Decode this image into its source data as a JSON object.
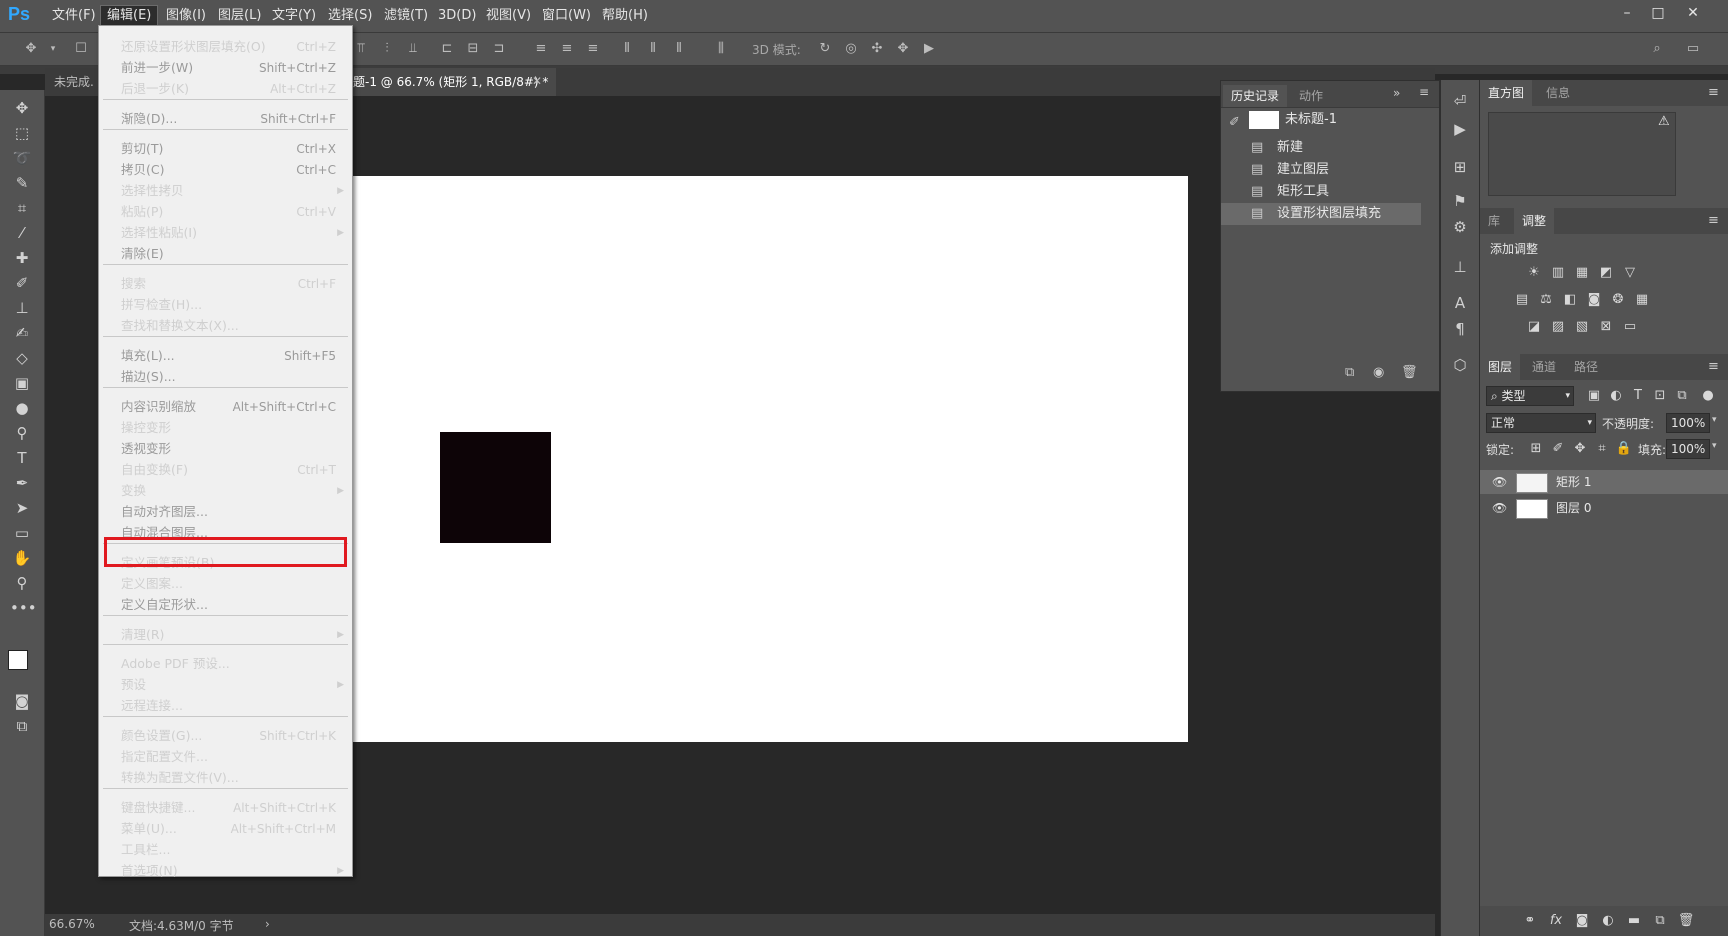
{
  "app": {
    "logo": "Ps"
  },
  "menubar": {
    "items": [
      "文件(F)",
      "编辑(E)",
      "图像(I)",
      "图层(L)",
      "文字(Y)",
      "选择(S)",
      "滤镜(T)",
      "3D(D)",
      "视图(V)",
      "窗口(W)",
      "帮助(H)"
    ],
    "window_controls": [
      "minimize-icon",
      "maximize-icon",
      "close-icon"
    ]
  },
  "options_bar": {
    "mode_label": "3D 模式:"
  },
  "document": {
    "tab_left": "未完成.",
    "tab_active": "题-1 @ 66.7% (矩形 1, RGB/8#) *",
    "status_zoom": "66.67%",
    "status_doc": "文档:4.63M/0 字节"
  },
  "history_panel": {
    "tabs": [
      "历史记录",
      "动作"
    ],
    "snapshot": "未标题-1",
    "items": [
      "新建",
      "建立图层",
      "矩形工具",
      "设置形状图层填充"
    ]
  },
  "histogram_panel": {
    "tabs": [
      "直方图",
      "信息"
    ]
  },
  "adjustments_panel": {
    "tabs": [
      "库",
      "调整"
    ],
    "title": "添加调整"
  },
  "layers_panel": {
    "tabs": [
      "图层",
      "通道",
      "路径"
    ],
    "filter_label": "类型",
    "blend_mode": "正常",
    "opacity_label": "不透明度:",
    "opacity_value": "100%",
    "lock_label": "锁定:",
    "fill_label": "填充:",
    "fill_value": "100%",
    "layers": [
      "矩形 1",
      "图层 0"
    ]
  },
  "edit_menu": {
    "items": [
      {
        "label": "还原设置形状图层填充(O)",
        "shortcut": "Ctrl+Z",
        "disabled": false
      },
      {
        "label": "前进一步(W)",
        "shortcut": "Shift+Ctrl+Z",
        "disabled": true
      },
      {
        "label": "后退一步(K)",
        "shortcut": "Alt+Ctrl+Z",
        "disabled": false
      },
      {
        "label": "渐隐(D)...",
        "shortcut": "Shift+Ctrl+F",
        "disabled": true
      },
      {
        "label": "剪切(T)",
        "shortcut": "Ctrl+X",
        "disabled": true
      },
      {
        "label": "拷贝(C)",
        "shortcut": "Ctrl+C",
        "disabled": true
      },
      {
        "label": "选择性拷贝",
        "shortcut": "",
        "disabled": false
      },
      {
        "label": "粘贴(P)",
        "shortcut": "Ctrl+V",
        "disabled": false
      },
      {
        "label": "选择性粘贴(I)",
        "shortcut": "",
        "disabled": false
      },
      {
        "label": "清除(E)",
        "shortcut": "",
        "disabled": true
      },
      {
        "label": "搜索",
        "shortcut": "Ctrl+F",
        "disabled": false
      },
      {
        "label": "拼写检查(H)...",
        "shortcut": "",
        "disabled": false
      },
      {
        "label": "查找和替换文本(X)...",
        "shortcut": "",
        "disabled": false
      },
      {
        "label": "填充(L)...",
        "shortcut": "Shift+F5",
        "disabled": true
      },
      {
        "label": "描边(S)...",
        "shortcut": "",
        "disabled": true
      },
      {
        "label": "内容识别缩放",
        "shortcut": "Alt+Shift+Ctrl+C",
        "disabled": true
      },
      {
        "label": "操控变形",
        "shortcut": "",
        "disabled": false
      },
      {
        "label": "透视变形",
        "shortcut": "",
        "disabled": true
      },
      {
        "label": "自由变换(F)",
        "shortcut": "Ctrl+T",
        "disabled": false
      },
      {
        "label": "变换",
        "shortcut": "",
        "disabled": false
      },
      {
        "label": "自动对齐图层...",
        "shortcut": "",
        "disabled": true
      },
      {
        "label": "自动混合图层...",
        "shortcut": "",
        "disabled": true
      },
      {
        "label": "定义画笔预设(B)...",
        "shortcut": "",
        "disabled": false
      },
      {
        "label": "定义图案...",
        "shortcut": "",
        "disabled": false
      },
      {
        "label": "定义自定形状...",
        "shortcut": "",
        "disabled": true
      },
      {
        "label": "清理(R)",
        "shortcut": "",
        "disabled": false
      },
      {
        "label": "Adobe PDF 预设...",
        "shortcut": "",
        "disabled": false
      },
      {
        "label": "预设",
        "shortcut": "",
        "disabled": false
      },
      {
        "label": "远程连接...",
        "shortcut": "",
        "disabled": false
      },
      {
        "label": "颜色设置(G)...",
        "shortcut": "Shift+Ctrl+K",
        "disabled": false
      },
      {
        "label": "指定配置文件...",
        "shortcut": "",
        "disabled": false
      },
      {
        "label": "转换为配置文件(V)...",
        "shortcut": "",
        "disabled": false
      },
      {
        "label": "键盘快捷键...",
        "shortcut": "Alt+Shift+Ctrl+K",
        "disabled": false
      },
      {
        "label": "菜单(U)...",
        "shortcut": "Alt+Shift+Ctrl+M",
        "disabled": false
      },
      {
        "label": "工具栏...",
        "shortcut": "",
        "disabled": false
      },
      {
        "label": "首选项(N)",
        "shortcut": "",
        "disabled": false
      }
    ]
  },
  "colors": {
    "highlight": "#e0191f",
    "ps_blue": "#31a8ff"
  }
}
